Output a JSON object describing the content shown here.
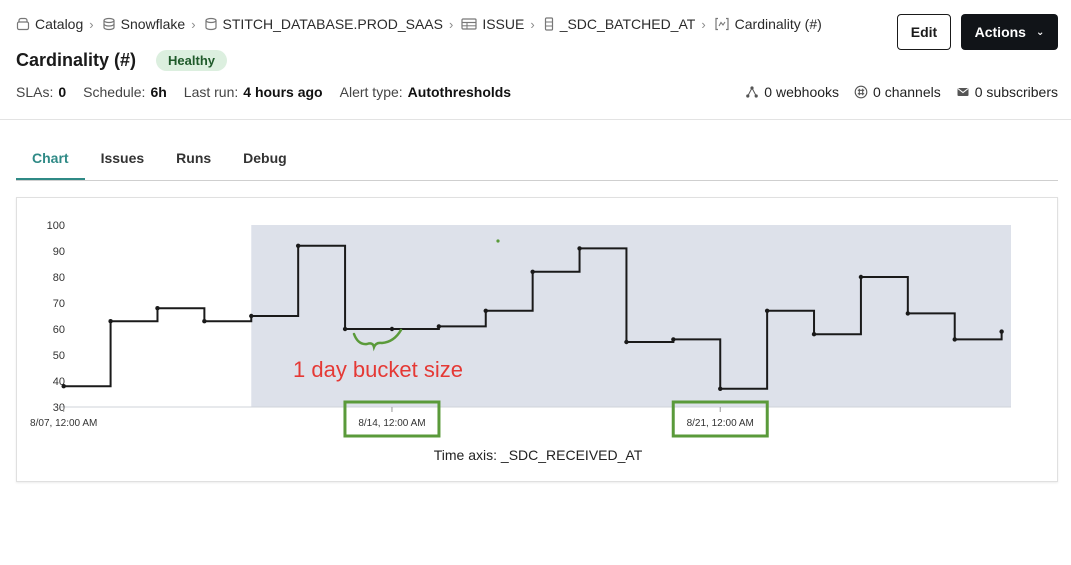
{
  "breadcrumb": [
    {
      "label": "Catalog",
      "icon": "catalog-icon"
    },
    {
      "label": "Snowflake",
      "icon": "database-icon"
    },
    {
      "label": "STITCH_DATABASE.PROD_SAAS",
      "icon": "schema-icon"
    },
    {
      "label": "ISSUE",
      "icon": "table-icon"
    },
    {
      "label": "_SDC_BATCHED_AT",
      "icon": "column-icon"
    },
    {
      "label": "Cardinality (#)",
      "icon": "metric-icon"
    }
  ],
  "header": {
    "title": "Cardinality (#)",
    "status": "Healthy",
    "edit_label": "Edit",
    "actions_label": "Actions"
  },
  "meta": {
    "slas_label": "SLAs:",
    "slas_value": "0",
    "schedule_label": "Schedule:",
    "schedule_value": "6h",
    "last_run_label": "Last run:",
    "last_run_value": "4 hours ago",
    "alert_type_label": "Alert type:",
    "alert_type_value": "Autothresholds"
  },
  "counts": {
    "webhooks": "0 webhooks",
    "channels": "0 channels",
    "subscribers": "0 subscribers"
  },
  "tabs": [
    {
      "label": "Chart",
      "active": true
    },
    {
      "label": "Issues",
      "active": false
    },
    {
      "label": "Runs",
      "active": false
    },
    {
      "label": "Debug",
      "active": false
    }
  ],
  "colors": {
    "accent": "#2f8a86",
    "band": "#dde1ea",
    "line": "#1a1a1a",
    "annotation_red": "#e53935",
    "annotation_green": "#5a9a3a",
    "badge_bg": "#dcefdf"
  },
  "chart_data": {
    "type": "line",
    "step": true,
    "xlabel": "Time axis: _SDC_RECEIVED_AT",
    "ylabel": "",
    "ylim": [
      30,
      100
    ],
    "y_ticks": [
      30,
      40,
      50,
      60,
      70,
      80,
      90,
      100
    ],
    "x_tick_labels": [
      "8/07, 12:00 AM",
      "8/14, 12:00 AM",
      "8/21, 12:00 AM"
    ],
    "x_tick_days": [
      0,
      7,
      14
    ],
    "x_range_days": [
      -0.1,
      20.2
    ],
    "band_days": [
      4,
      20.2
    ],
    "x_days": [
      0,
      1,
      2,
      3,
      4,
      5,
      6,
      7,
      8,
      9,
      10,
      11,
      12,
      13,
      14,
      15,
      16,
      17,
      18,
      19,
      20
    ],
    "values": [
      38,
      63,
      68,
      63,
      65,
      92,
      60,
      60,
      61,
      67,
      82,
      91,
      55,
      56,
      37,
      67,
      58,
      80,
      66,
      56,
      59
    ],
    "annotation": "1 day bucket size",
    "highlight_tick_days": [
      7,
      14
    ]
  }
}
